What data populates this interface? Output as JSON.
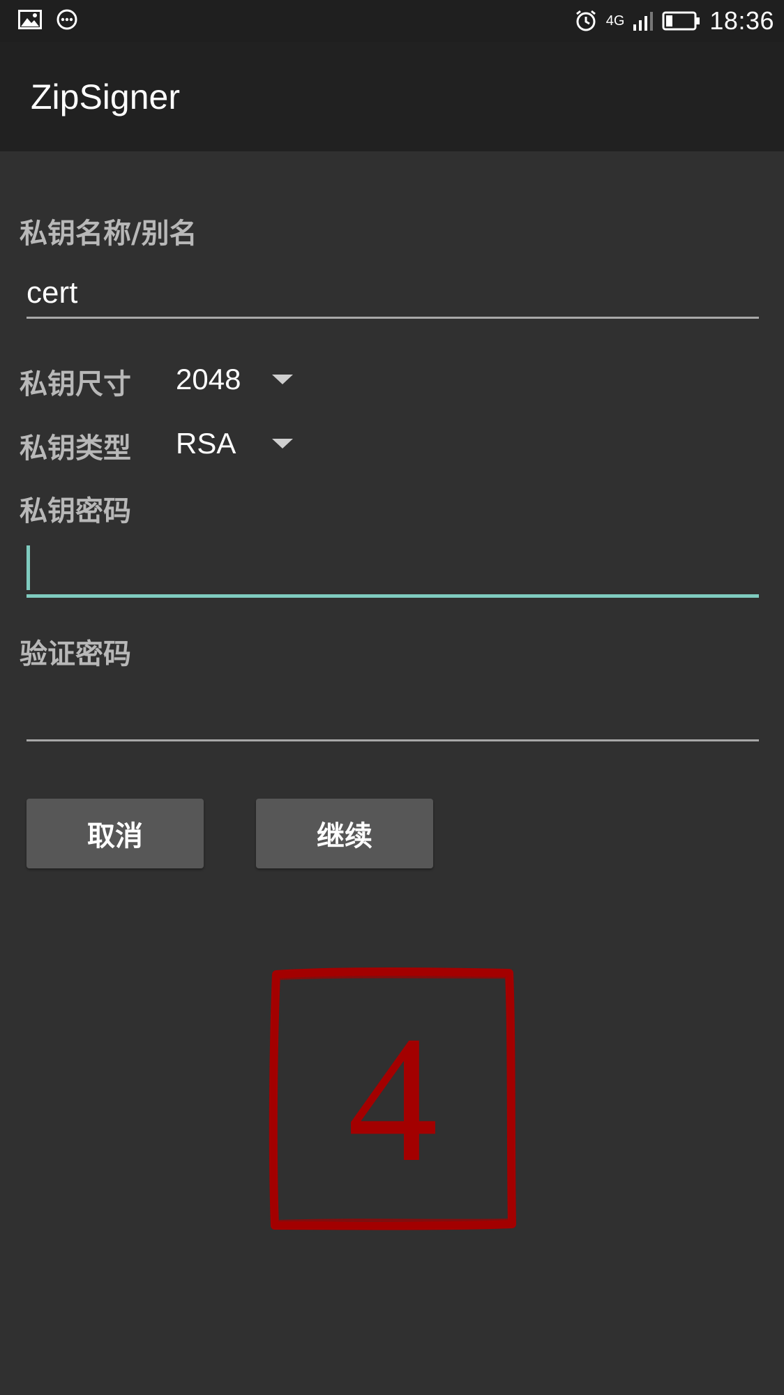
{
  "status_bar": {
    "time": "18:36",
    "network": "4G",
    "icons": [
      "image-icon",
      "message-icon",
      "alarm-icon",
      "signal-icon",
      "battery-icon"
    ]
  },
  "app_bar": {
    "title": "ZipSigner"
  },
  "form": {
    "alias": {
      "label": "私钥名称/别名",
      "value": "cert"
    },
    "key_size": {
      "label": "私钥尺寸",
      "value": "2048"
    },
    "key_type": {
      "label": "私钥类型",
      "value": "RSA"
    },
    "password": {
      "label": "私钥密码",
      "value": ""
    },
    "confirm_password": {
      "label": "验证密码",
      "value": ""
    }
  },
  "buttons": {
    "cancel": "取消",
    "continue": "继续"
  },
  "stamp": {
    "digit": "4",
    "color": "#a30000"
  },
  "colors": {
    "accent": "#7fcbbf",
    "background": "#303030",
    "app_bar": "#212121",
    "button": "#575757"
  }
}
